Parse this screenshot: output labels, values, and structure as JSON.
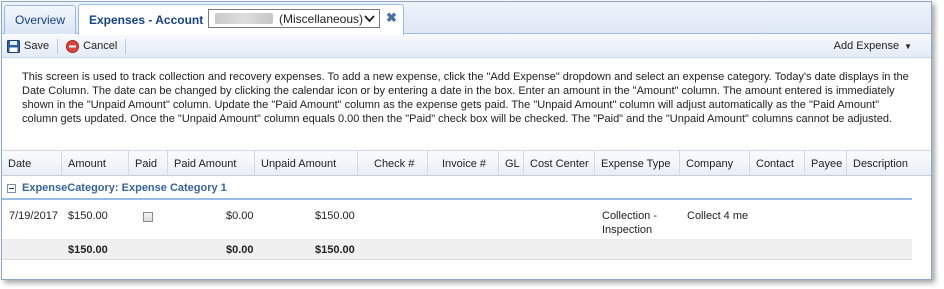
{
  "tabs": {
    "overview": "Overview",
    "expenses": "Expenses - Account",
    "account_select_value": "(Miscellaneous)"
  },
  "toolbar": {
    "save": "Save",
    "cancel": "Cancel",
    "add_expense": "Add Expense"
  },
  "description": "This screen is used to track collection and recovery expenses. To add a new expense, click the \"Add Expense\" dropdown and select an expense category. Today's date displays in the Date Column. The date can be changed by clicking the calendar icon or by entering a date in the box. Enter an amount in the \"Amount\" column. The amount entered is immediately shown in the \"Unpaid Amount\" column. Update the \"Paid Amount\" column as the expense gets paid. The \"Unpaid Amount\" column will adjust automatically as the \"Paid Amount\" column gets updated. Once the \"Unpaid Amount\" column equals 0.00 then the \"Paid\" check box will be checked. The \"Paid\" and the \"Unpaid Amount\" columns cannot be adjusted.",
  "columns": [
    "Date",
    "Amount",
    "Paid",
    "Paid Amount",
    "Unpaid Amount",
    "Check #",
    "Invoice #",
    "GL",
    "Cost Center",
    "Expense Type",
    "Company",
    "Contact",
    "Payee",
    "Description"
  ],
  "group": {
    "label": "ExpenseCategory: Expense Category 1"
  },
  "row": {
    "date": "7/19/2017",
    "amount": "$150.00",
    "paid_checked": false,
    "paid_amount": "$0.00",
    "unpaid_amount": "$150.00",
    "expense_type_line1": "Collection -",
    "expense_type_line2": "Inspection",
    "company": "Collect 4 me"
  },
  "totals": {
    "amount": "$150.00",
    "paid_amount": "$0.00",
    "unpaid_amount": "$150.00"
  },
  "colors": {
    "tab_text": "#15428b",
    "group_text": "#3764a0",
    "cancel_icon": "#d9453d",
    "save_icon": "#2f5fa7"
  },
  "icons": {
    "save": "floppy-disk-icon",
    "cancel": "cancel-circle-icon",
    "close": "close-icon",
    "dropdown": "chevron-down-icon",
    "group_toggle": "collapse-minus-icon"
  }
}
